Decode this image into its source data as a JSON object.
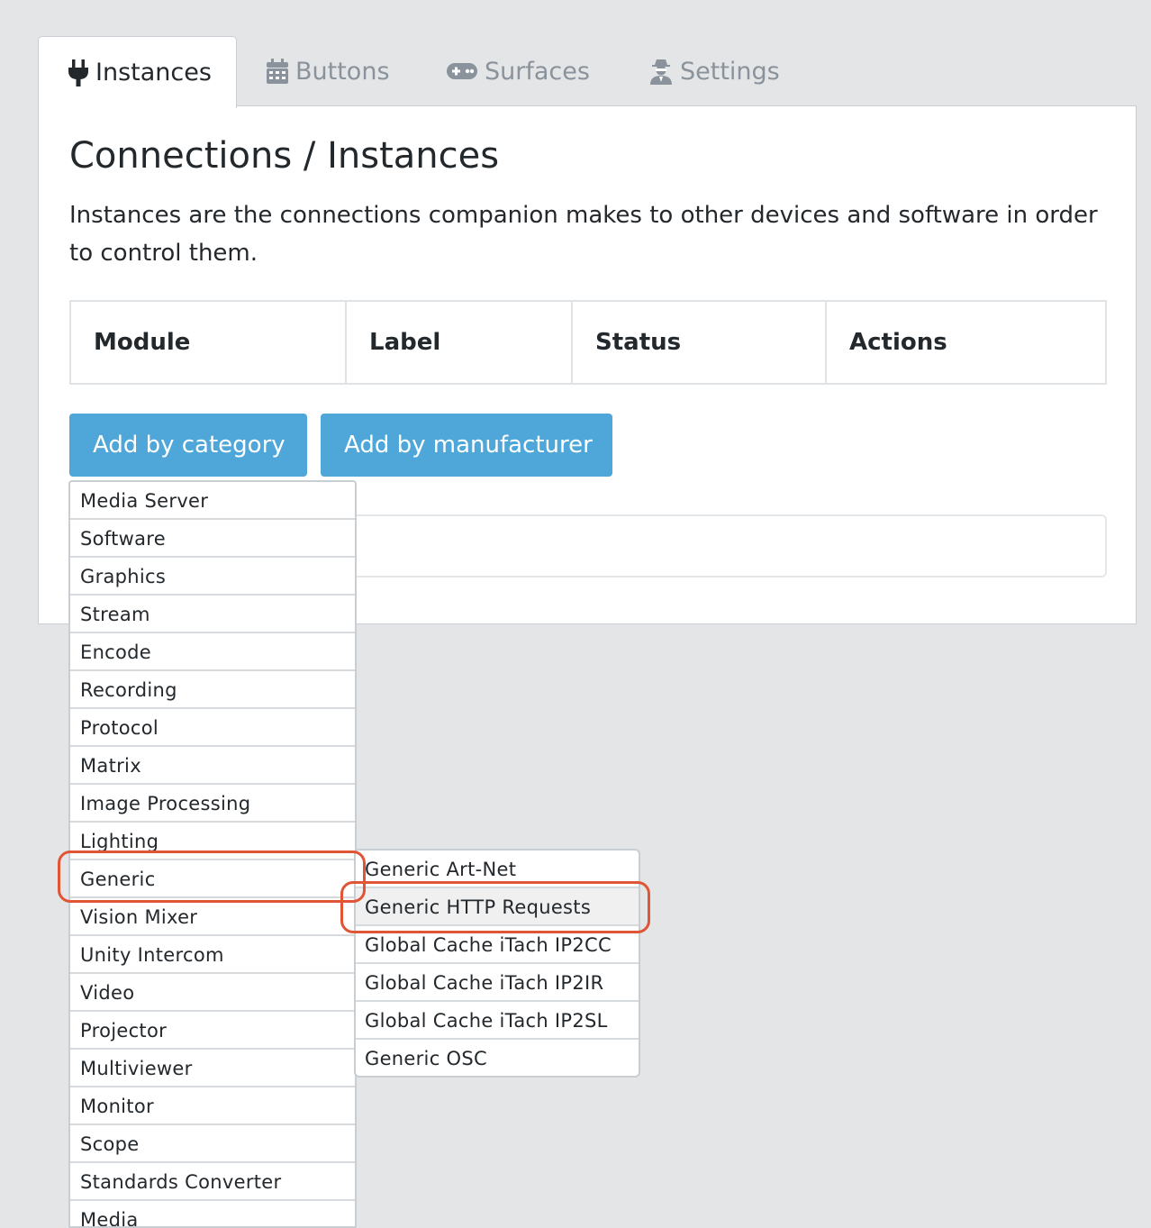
{
  "tabs": [
    {
      "label": "Instances",
      "icon": "plug-icon",
      "active": true
    },
    {
      "label": "Buttons",
      "icon": "calendar-icon",
      "active": false
    },
    {
      "label": "Surfaces",
      "icon": "gamepad-icon",
      "active": false
    },
    {
      "label": "Settings",
      "icon": "user-secret-icon",
      "active": false
    }
  ],
  "page": {
    "title": "Connections / Instances",
    "description": "Instances are the connections companion makes to other devices and software in order to control them."
  },
  "table": {
    "headers": [
      "Module",
      "Label",
      "Status",
      "Actions"
    ]
  },
  "buttons": {
    "add_by_category": "Add by category",
    "add_by_manufacturer": "Add by manufacturer"
  },
  "category_menu": {
    "items": [
      "Media Server",
      "Software",
      "Graphics",
      "Stream",
      "Encode",
      "Recording",
      "Protocol",
      "Matrix",
      "Image Processing",
      "Lighting",
      "Generic",
      "Vision Mixer",
      "Unity Intercom",
      "Video",
      "Projector",
      "Multiviewer",
      "Monitor",
      "Scope",
      "Standards Converter",
      "Media"
    ],
    "highlighted": "Generic"
  },
  "sub_menu": {
    "items": [
      "Generic Art-Net",
      "Generic HTTP Requests",
      "Global Cache iTach IP2CC",
      "Global Cache iTach IP2IR",
      "Global Cache iTach IP2SL",
      "Generic OSC"
    ],
    "hovered": "Generic HTTP Requests"
  },
  "colors": {
    "primary_button": "#4ea7d8",
    "highlight_outline": "#e05535",
    "background": "#e4e5e7"
  }
}
